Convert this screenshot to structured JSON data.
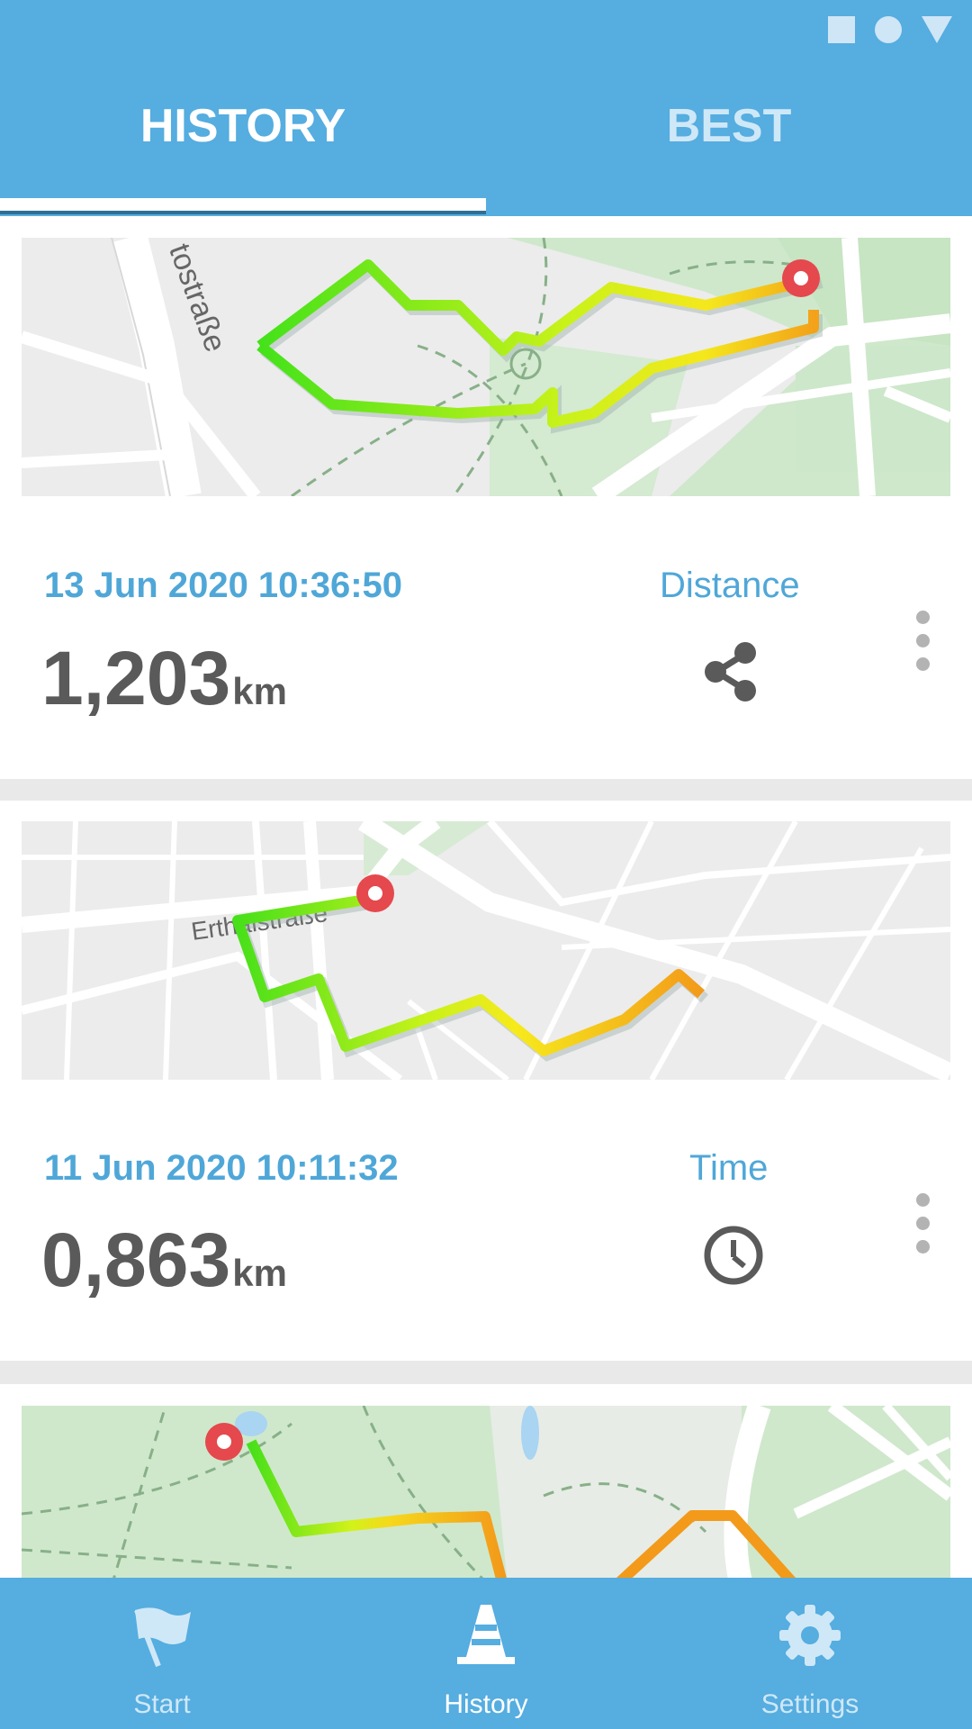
{
  "colors": {
    "primary": "#55ade0",
    "accent_text": "#4fa7d8",
    "value_text": "#5a5a5a",
    "marker": "#e5484d"
  },
  "tabs": [
    {
      "label": "HISTORY",
      "active": true
    },
    {
      "label": "BEST",
      "active": false
    }
  ],
  "entries": [
    {
      "date": "13 Jun 2020 10:36:50",
      "distance": "1,203",
      "unit": "km",
      "metric_label": "Distance",
      "metric_icon": "share-icon",
      "map_street": "tostraße"
    },
    {
      "date": "11 Jun 2020 10:11:32",
      "distance": "0,863",
      "unit": "km",
      "metric_label": "Time",
      "metric_icon": "clock-icon",
      "map_street": "Erthalstraße"
    },
    {
      "map_only": true
    }
  ],
  "bottom_nav": [
    {
      "label": "Start",
      "icon": "flag-icon",
      "active": false
    },
    {
      "label": "History",
      "icon": "cone-icon",
      "active": true
    },
    {
      "label": "Settings",
      "icon": "gear-icon",
      "active": false
    }
  ]
}
